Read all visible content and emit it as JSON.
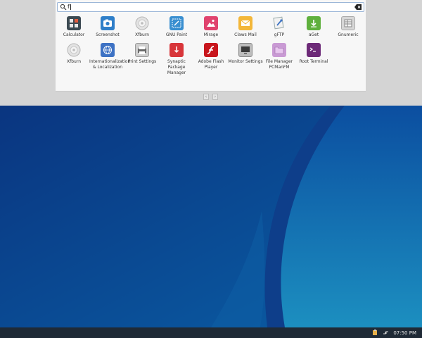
{
  "search": {
    "query": "f"
  },
  "apps_row1": [
    {
      "label": "Calculator",
      "icon": "calculator-icon"
    },
    {
      "label": "Screenshot",
      "icon": "camera-icon"
    },
    {
      "label": "Xfburn",
      "icon": "disc-icon"
    },
    {
      "label": "GNU Paint",
      "icon": "paint-icon"
    },
    {
      "label": "Mirage",
      "icon": "image-viewer-icon"
    },
    {
      "label": "Claws Mail",
      "icon": "mail-icon"
    },
    {
      "label": "gFTP",
      "icon": "ftp-icon"
    },
    {
      "label": "aGet",
      "icon": "download-icon"
    },
    {
      "label": "Gnumeric",
      "icon": "spreadsheet-icon"
    }
  ],
  "apps_row2": [
    {
      "label": "Xfburn",
      "icon": "disc-icon"
    },
    {
      "label": "Internationalization & Localization",
      "icon": "globe-icon"
    },
    {
      "label": "Print Settings",
      "icon": "printer-icon"
    },
    {
      "label": "Synaptic Package Manager",
      "icon": "package-icon"
    },
    {
      "label": "Adobe Flash Player",
      "icon": "flash-icon"
    },
    {
      "label": "Monitor Settings",
      "icon": "monitor-icon"
    },
    {
      "label": "File Manager PCManFM",
      "icon": "folder-icon"
    },
    {
      "label": "Root Terminal",
      "icon": "terminal-icon"
    }
  ],
  "taskbar": {
    "clock": "07:50 PM"
  }
}
